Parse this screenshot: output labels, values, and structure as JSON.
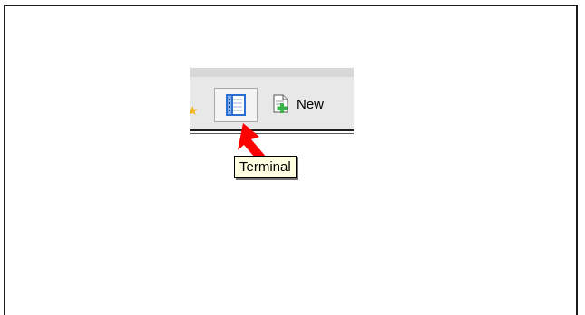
{
  "toolbar": {
    "new_label": "New",
    "tooltip_text": "Terminal",
    "icons": {
      "favorites": "star-icon",
      "terminal": "terminal-icon",
      "new_document": "new-document-icon"
    }
  },
  "annotation": {
    "arrow_color": "#ff0000",
    "pointing_at": "terminal-button"
  },
  "colors": {
    "tooltip_background": "#ffffe1",
    "terminal_icon_blue": "#2d6fd1",
    "new_icon_green": "#37b34a",
    "star_gold": "#f2b51c"
  }
}
